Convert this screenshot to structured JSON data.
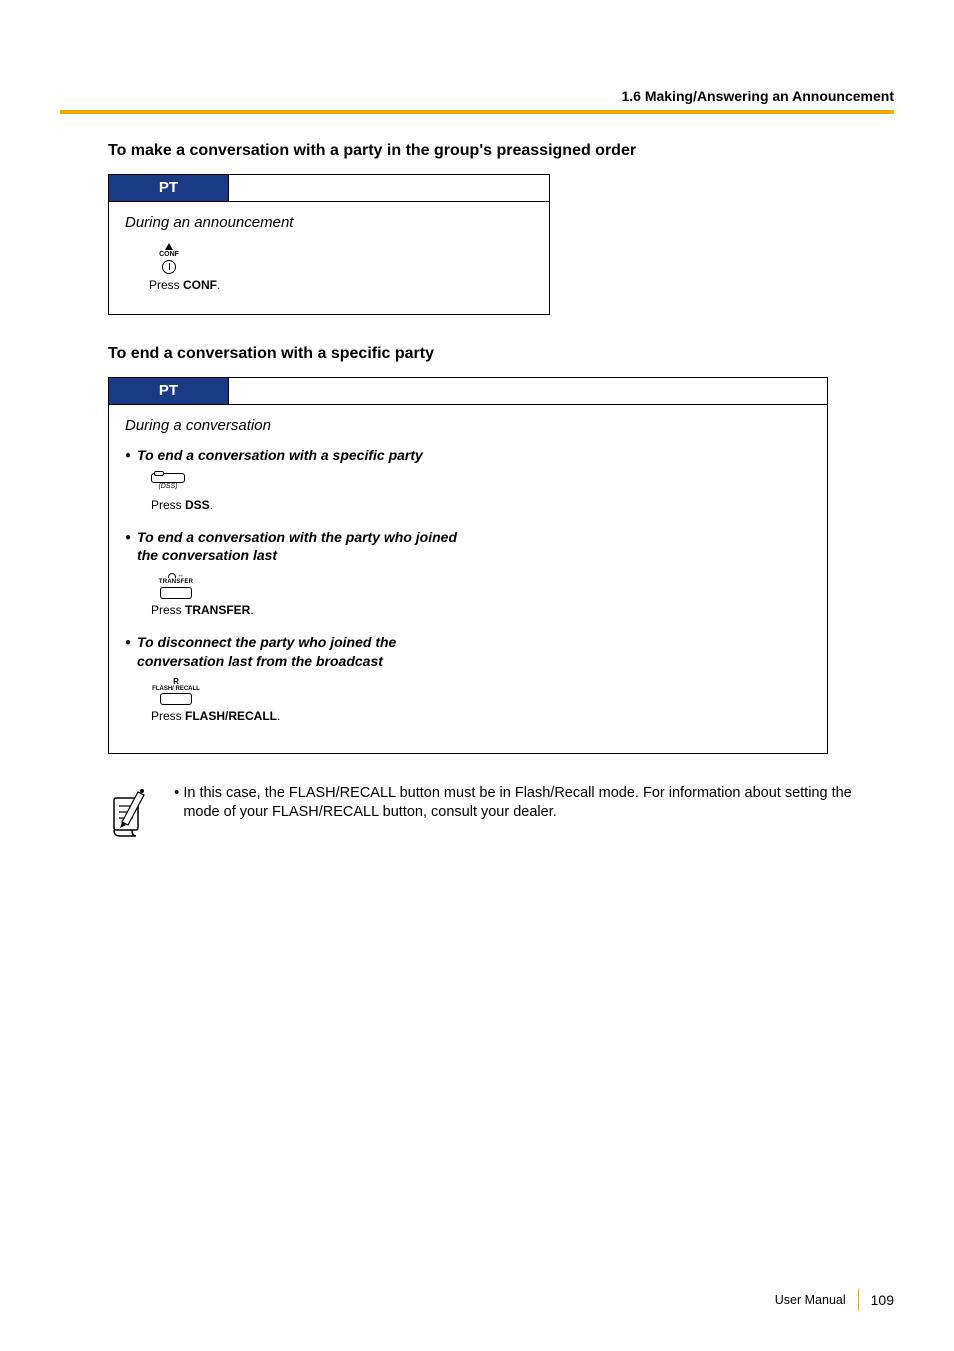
{
  "header": {
    "section": "1.6 Making/Answering an Announcement"
  },
  "titles": {
    "make": "To make a conversation with a party in the group's preassigned order",
    "end": "To end a conversation with a specific party"
  },
  "box1": {
    "tab": "PT",
    "context": "During an announcement",
    "conf_icon_label": "CONF",
    "press_prefix": "Press ",
    "press_btn": "CONF",
    "press_suffix": "."
  },
  "box2": {
    "tab": "PT",
    "context": "During a conversation",
    "b1": "To end a conversation with a specific party",
    "dss_icon_label": "(DSS)",
    "p1_prefix": "Press ",
    "p1_btn": "DSS",
    "p1_suffix": ".",
    "b2": "To end a conversation with the party who joined the conversation last",
    "transfer_icon_label": "TRANSFER",
    "p2_prefix": "Press ",
    "p2_btn": "TRANSFER",
    "p2_suffix": ".",
    "b3": "To disconnect the party who joined the conversation last from the broadcast",
    "flash_r": "R",
    "flash_icon_label": "FLASH/\nRECALL",
    "p3_prefix": "Press ",
    "p3_btn": "FLASH/RECALL",
    "p3_suffix": "."
  },
  "note": {
    "text": "In this case, the FLASH/RECALL button must be in Flash/Recall mode. For information about setting the mode of your FLASH/RECALL button, consult your dealer."
  },
  "footer": {
    "manual": "User Manual",
    "page": "109"
  }
}
